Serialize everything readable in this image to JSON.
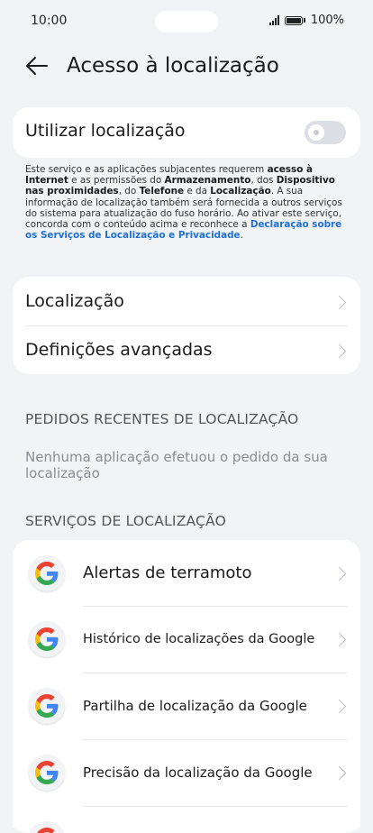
{
  "status_bar": {
    "time": "10:00",
    "battery": "100%"
  },
  "header": {
    "title": "Acesso à localização"
  },
  "use_location": {
    "label": "Utilizar localização",
    "enabled": false
  },
  "description": {
    "p1": "Este serviço e as aplicações subjacentes requerem ",
    "b1": "acesso à Internet",
    "p2": " e as permissões do ",
    "b2": "Armazenamento",
    "p3": ", dos ",
    "b3": "Dispositivo nas proximidades",
    "p4": ", do ",
    "b4": "Telefone",
    "p5": " e da ",
    "b5": "Localização",
    "p6": ". A sua informação de localização também será fornecida a outros serviços do sistema para atualização do fuso horário. Ao ativar este serviço, concorda com o conteúdo acima e reconhece a ",
    "link": "Declaração sobre os Serviços de Localização e Privacidade",
    "p7": "."
  },
  "settings": {
    "location": "Localização",
    "advanced": "Definições avançadas"
  },
  "recent": {
    "title": "PEDIDOS RECENTES DE LOCALIZAÇÃO",
    "empty": "Nenhuma aplicação efetuou o pedido da sua localização"
  },
  "services": {
    "title": "SERVIÇOS DE LOCALIZAÇÃO",
    "items": [
      {
        "label": "Alertas de terramoto"
      },
      {
        "label": "Histórico de localizações da Google"
      },
      {
        "label": "Partilha de localização da Google"
      },
      {
        "label": "Precisão da localização da Google"
      }
    ]
  },
  "colors": {
    "accent": "#1f6fd6",
    "background": "#f1f3f5",
    "card": "#ffffff"
  }
}
